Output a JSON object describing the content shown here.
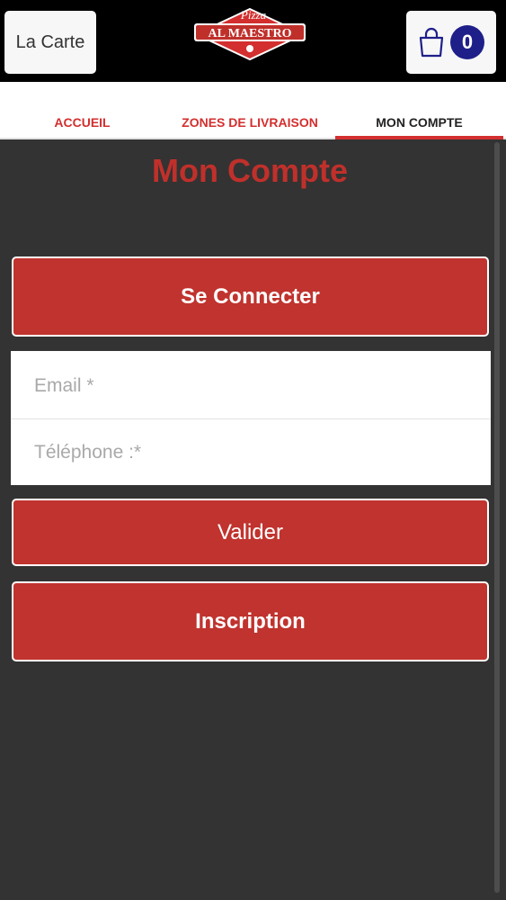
{
  "header": {
    "menu_label": "La Carte",
    "cart_count": "0",
    "logo": {
      "script_text": "Pizza",
      "brand_text": "AL MAESTRO"
    }
  },
  "tabs": [
    {
      "label": "ACCUEIL",
      "active": false
    },
    {
      "label": "ZONES DE LIVRAISON",
      "active": false
    },
    {
      "label": "MON COMPTE",
      "active": true
    }
  ],
  "page": {
    "title": "Mon Compte",
    "connect_label": "Se Connecter",
    "email_placeholder": "Email *",
    "phone_placeholder": "Téléphone :*",
    "submit_label": "Valider",
    "register_label": "Inscription"
  },
  "colors": {
    "accent": "#c0332e",
    "background": "#333333",
    "cart_badge": "#1f1f8a"
  }
}
